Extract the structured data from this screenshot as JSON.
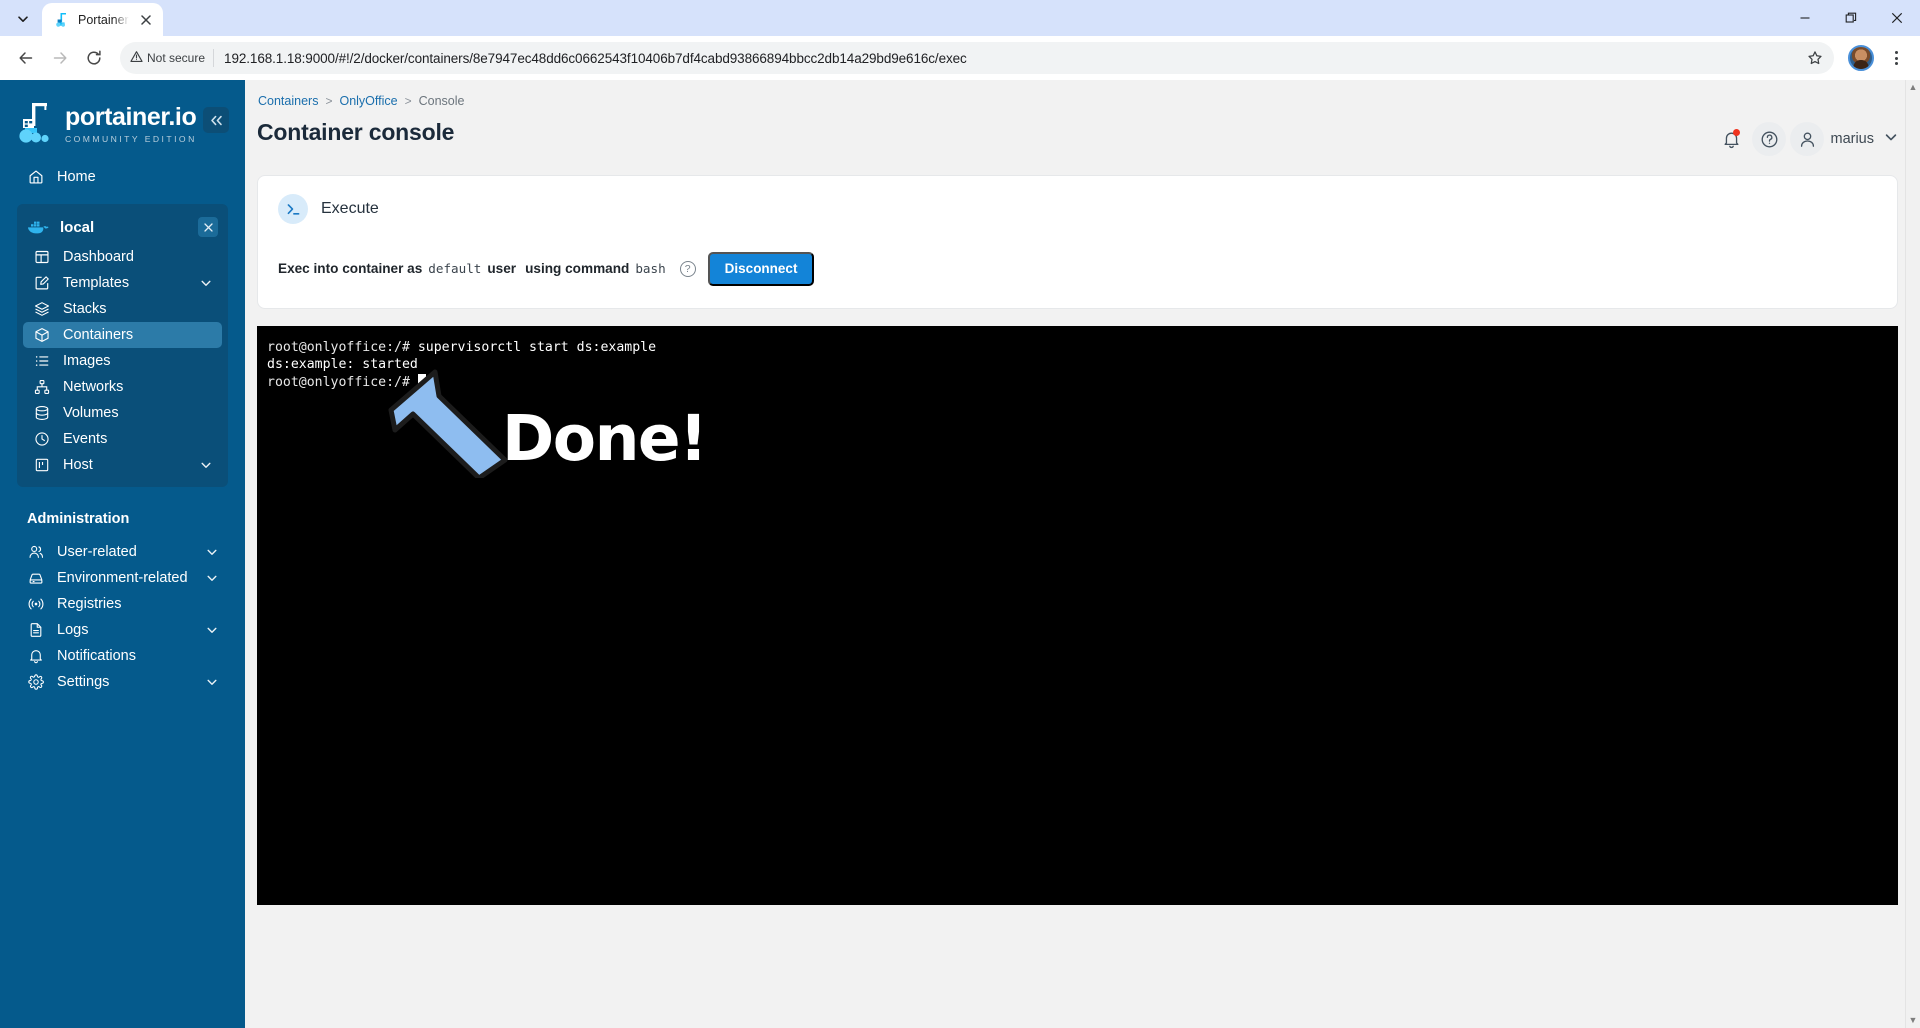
{
  "browser": {
    "tab": {
      "title": "Portainer",
      "favicon_icon": "portainer-favicon",
      "close_icon": "close-icon"
    },
    "tab_list_icon": "chevron-down-icon",
    "window_controls": {
      "minimize": "minimize-icon",
      "maximize": "restore-icon",
      "close": "close-icon"
    },
    "toolbar": {
      "back_icon": "arrow-left-icon",
      "forward_icon": "arrow-right-icon",
      "reload_icon": "reload-icon",
      "security_label": "Not secure",
      "security_icon": "warning-triangle-icon",
      "url": "192.168.1.18:9000/#!/2/docker/containers/8e7947ec48dd6c0662543f10406b7df4cabd93866894bbcc2db14a29bd9e616c/exec",
      "bookmark_icon": "star-icon",
      "profile_icon": "profile-avatar",
      "menu_icon": "kebab-menu-icon"
    }
  },
  "sidebar": {
    "brand": {
      "name": "portainer.io",
      "subtitle": "COMMUNITY EDITION",
      "logo_icon": "portainer-logo"
    },
    "collapse_label": "«",
    "home": {
      "label": "Home",
      "icon": "home-icon"
    },
    "environment": {
      "name": "local",
      "icon": "docker-whale-icon",
      "close_label": "×",
      "items": [
        {
          "label": "Dashboard",
          "icon": "dashboard-icon",
          "expandable": false,
          "active": false
        },
        {
          "label": "Templates",
          "icon": "templates-icon",
          "expandable": true,
          "active": false
        },
        {
          "label": "Stacks",
          "icon": "stacks-icon",
          "expandable": false,
          "active": false
        },
        {
          "label": "Containers",
          "icon": "container-icon",
          "expandable": false,
          "active": true
        },
        {
          "label": "Images",
          "icon": "images-icon",
          "expandable": false,
          "active": false
        },
        {
          "label": "Networks",
          "icon": "networks-icon",
          "expandable": false,
          "active": false
        },
        {
          "label": "Volumes",
          "icon": "volumes-icon",
          "expandable": false,
          "active": false
        },
        {
          "label": "Events",
          "icon": "events-clock-icon",
          "expandable": false,
          "active": false
        },
        {
          "label": "Host",
          "icon": "host-icon",
          "expandable": true,
          "active": false
        }
      ]
    },
    "administration": {
      "title": "Administration",
      "items": [
        {
          "label": "User-related",
          "icon": "users-icon",
          "expandable": true
        },
        {
          "label": "Environment-related",
          "icon": "environment-icon",
          "expandable": true
        },
        {
          "label": "Registries",
          "icon": "registries-icon",
          "expandable": false
        },
        {
          "label": "Logs",
          "icon": "logs-icon",
          "expandable": true
        },
        {
          "label": "Notifications",
          "icon": "bell-icon",
          "expandable": false
        },
        {
          "label": "Settings",
          "icon": "gear-icon",
          "expandable": true
        }
      ]
    }
  },
  "header": {
    "breadcrumb": [
      {
        "label": "Containers",
        "type": "link"
      },
      {
        "label": ">",
        "type": "sep"
      },
      {
        "label": "OnlyOffice",
        "type": "link"
      },
      {
        "label": ">",
        "type": "sep"
      },
      {
        "label": "Console",
        "type": "current"
      }
    ],
    "title": "Container console",
    "notifications_icon": "bell-icon",
    "help_icon": "help-circle-icon",
    "user_icon": "user-icon",
    "username": "marius",
    "user_chevron_icon": "chevron-down-icon"
  },
  "console_card": {
    "icon": "terminal-prompt-icon",
    "title": "Execute",
    "exec_prefix": "Exec into container as",
    "exec_user": "default",
    "exec_middle": "user",
    "exec_command_label": "using command",
    "exec_command": "bash",
    "help_icon": "help-circle-icon",
    "disconnect_label": "Disconnect",
    "accent_color": "#1384d8"
  },
  "terminal": {
    "lines": [
      {
        "prompt": "root@onlyoffice:/# ",
        "command": "supervisorctl start ds:example"
      },
      {
        "prompt": "",
        "command": "ds:example: started"
      },
      {
        "prompt": "root@onlyoffice:/# ",
        "command": "",
        "cursor": true
      }
    ],
    "background": "#000000",
    "foreground": "#ffffff",
    "annotation_text": "Done!",
    "annotation_arrow_icon": "arrow-up-left-annotation",
    "annotation_arrow_color": "#8ebdf0"
  },
  "scrollbar": {
    "up_icon": "triangle-up-icon",
    "down_icon": "triangle-down-icon"
  }
}
